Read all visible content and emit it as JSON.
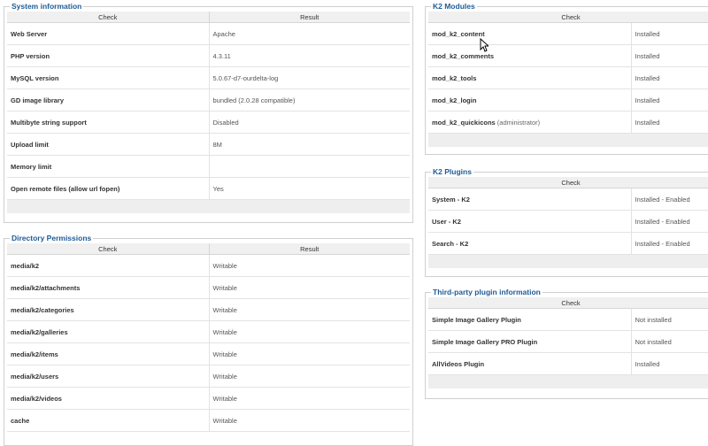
{
  "system_info": {
    "legend": "System information",
    "header": {
      "check": "Check",
      "result": "Result"
    },
    "rows": [
      {
        "check": "Web Server",
        "result": "Apache"
      },
      {
        "check": "PHP version",
        "result": "4.3.11"
      },
      {
        "check": "MySQL version",
        "result": "5.0.67-d7-ourdelta-log"
      },
      {
        "check": "GD image library",
        "result": "bundled (2.0.28 compatible)"
      },
      {
        "check": "Multibyte string support",
        "result": "Disabled"
      },
      {
        "check": "Upload limit",
        "result": "8M"
      },
      {
        "check": "Memory limit",
        "result": ""
      },
      {
        "check": "Open remote files (allow url fopen)",
        "result": "Yes"
      }
    ]
  },
  "directory_permissions": {
    "legend": "Directory Permissions",
    "header": {
      "check": "Check",
      "result": "Result"
    },
    "rows": [
      {
        "check": "media/k2",
        "result": "Writable"
      },
      {
        "check": "media/k2/attachments",
        "result": "Writable"
      },
      {
        "check": "media/k2/categories",
        "result": "Writable"
      },
      {
        "check": "media/k2/galleries",
        "result": "Writable"
      },
      {
        "check": "media/k2/items",
        "result": "Writable"
      },
      {
        "check": "media/k2/users",
        "result": "Writable"
      },
      {
        "check": "media/k2/videos",
        "result": "Writable"
      },
      {
        "check": "cache",
        "result": "Writable"
      }
    ]
  },
  "k2_modules": {
    "legend": "K2 Modules",
    "header": {
      "check": "Check"
    },
    "rows": [
      {
        "check": "mod_k2_content",
        "note": "",
        "result": "Installed"
      },
      {
        "check": "mod_k2_comments",
        "note": "",
        "result": "Installed"
      },
      {
        "check": "mod_k2_tools",
        "note": "",
        "result": "Installed"
      },
      {
        "check": "mod_k2_login",
        "note": "",
        "result": "Installed"
      },
      {
        "check": "mod_k2_quickicons",
        "note": "(administrator)",
        "result": "Installed"
      }
    ]
  },
  "k2_plugins": {
    "legend": "K2 Plugins",
    "header": {
      "check": "Check"
    },
    "rows": [
      {
        "check": "System - K2",
        "result": "Installed - Enabled"
      },
      {
        "check": "User - K2",
        "result": "Installed - Enabled"
      },
      {
        "check": "Search - K2",
        "result": "Installed - Enabled"
      }
    ]
  },
  "third_party": {
    "legend": "Third-party plugin information",
    "header": {
      "check": "Check"
    },
    "rows": [
      {
        "check": "Simple Image Gallery Plugin",
        "result": "Not installed"
      },
      {
        "check": "Simple Image Gallery PRO Plugin",
        "result": "Not installed"
      },
      {
        "check": "AllVideos Plugin",
        "result": "Installed"
      }
    ]
  }
}
